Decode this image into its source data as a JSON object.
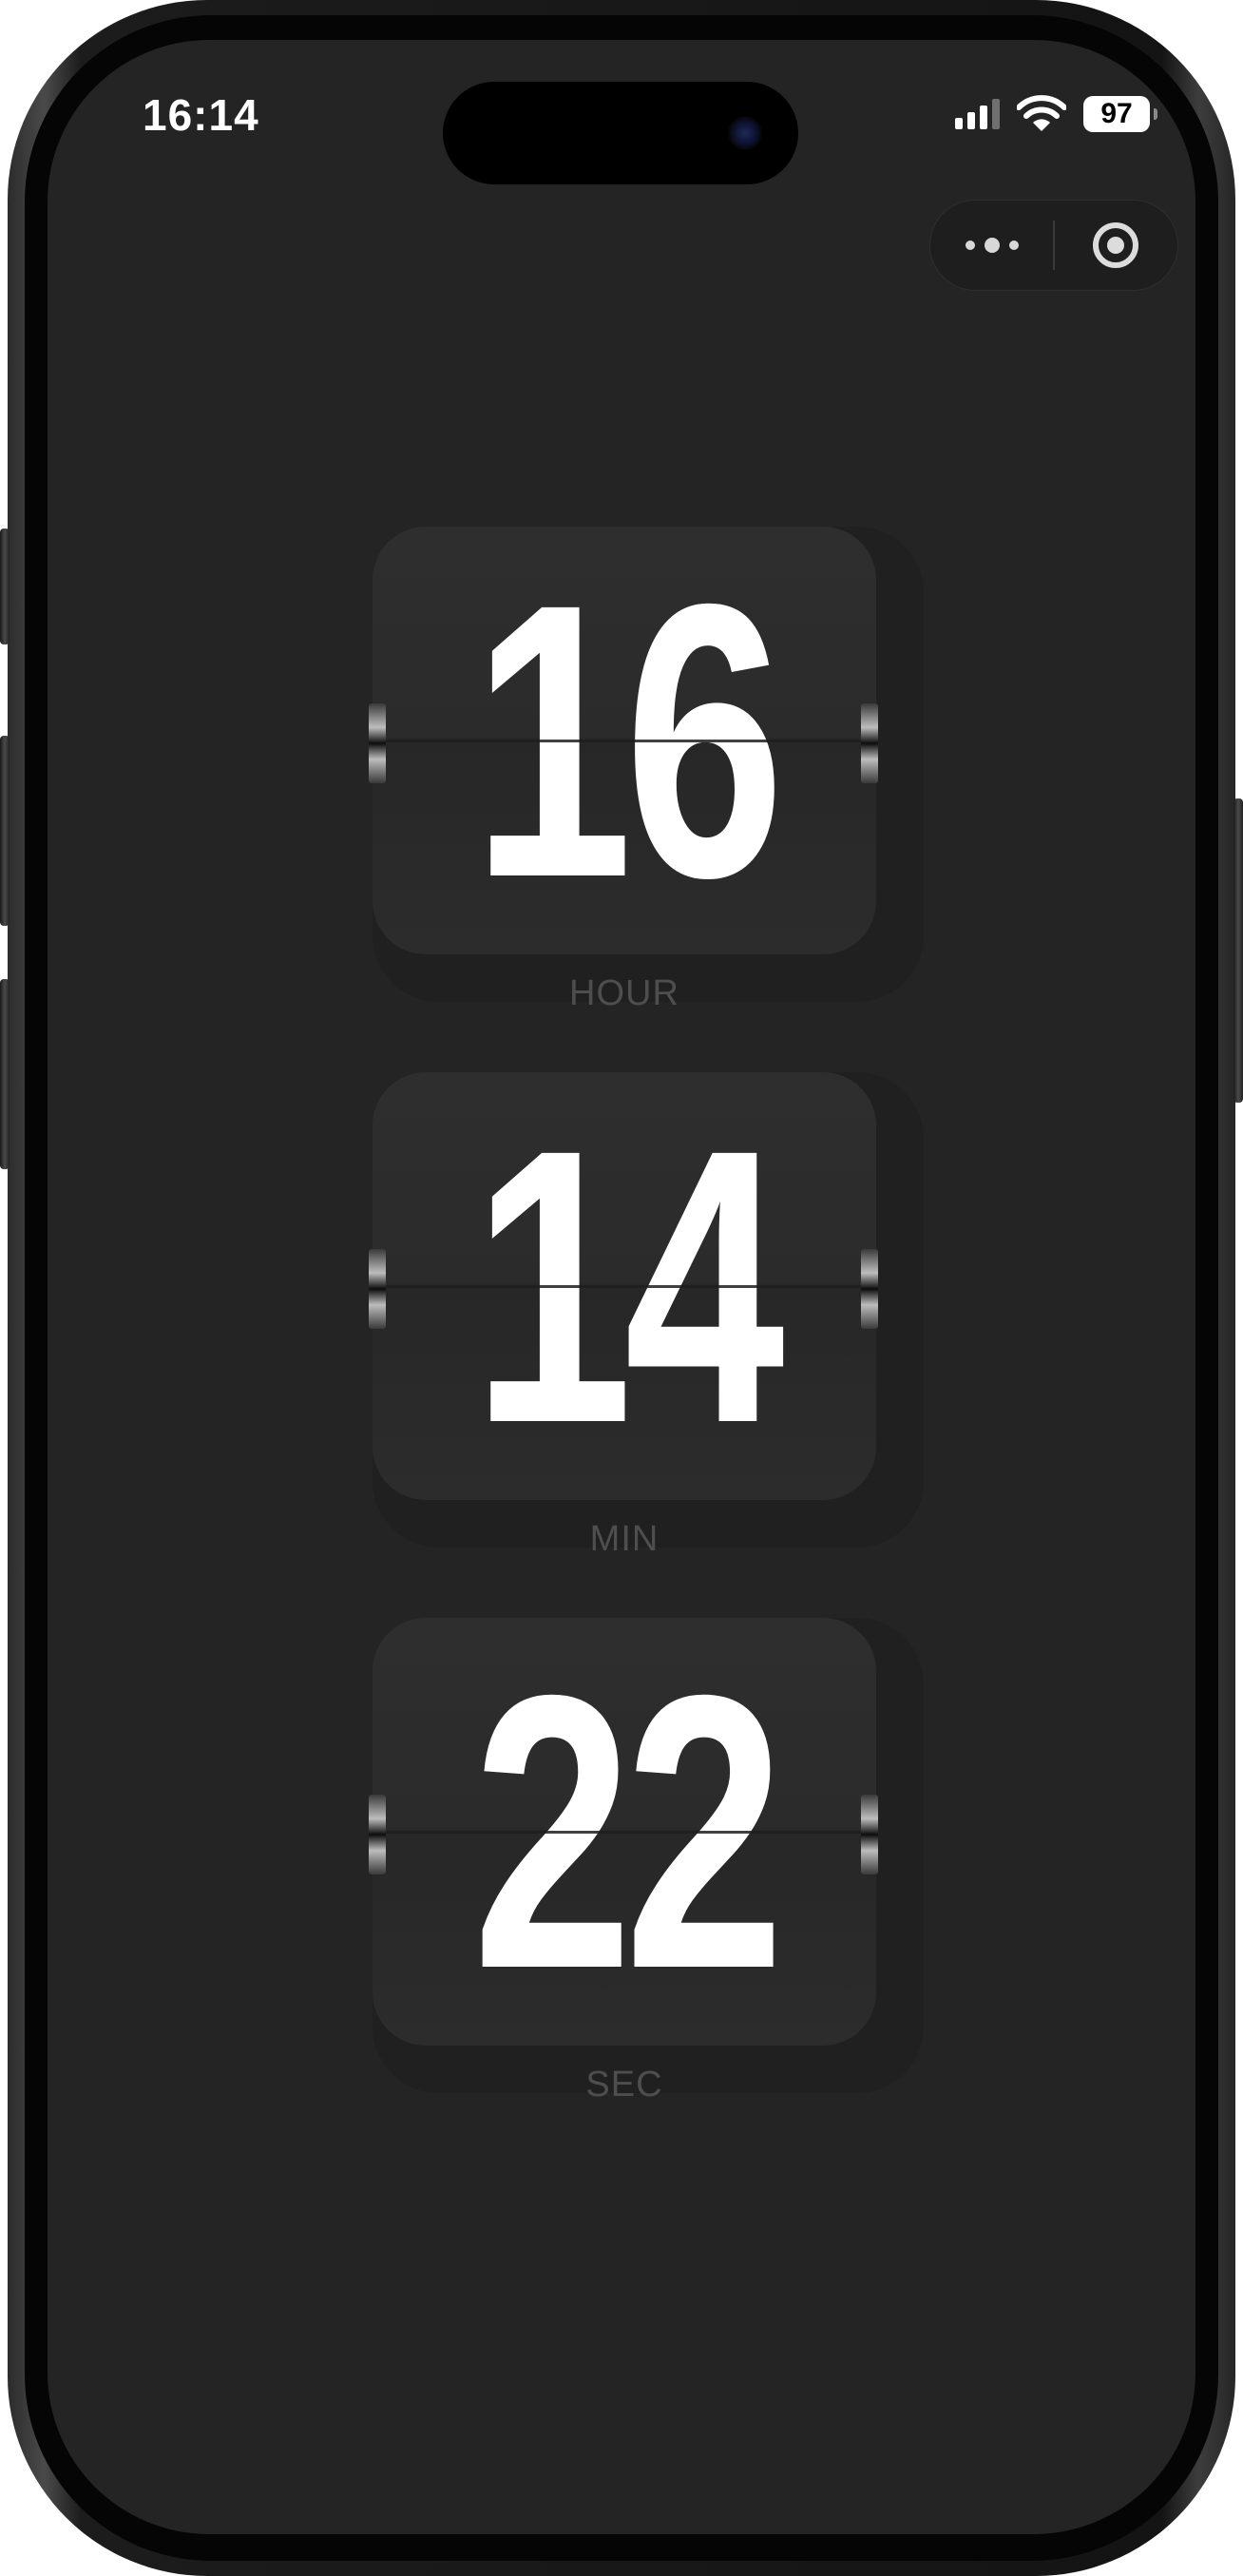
{
  "status_bar": {
    "time": "16:14",
    "battery_level": "97",
    "icons": [
      "signal-icon",
      "wifi-icon",
      "battery-icon"
    ]
  },
  "capsule": {
    "icons": [
      "more-dots-icon",
      "target-close-icon"
    ]
  },
  "clock": {
    "units": [
      {
        "digits": "16",
        "label": "HOUR"
      },
      {
        "digits": "14",
        "label": "MIN"
      },
      {
        "digits": "22",
        "label": "SEC"
      }
    ]
  },
  "colors": {
    "screen_background": "#242424",
    "card": "#2c2c2c",
    "digit": "#ffffff",
    "label": "#4e4e4e"
  }
}
